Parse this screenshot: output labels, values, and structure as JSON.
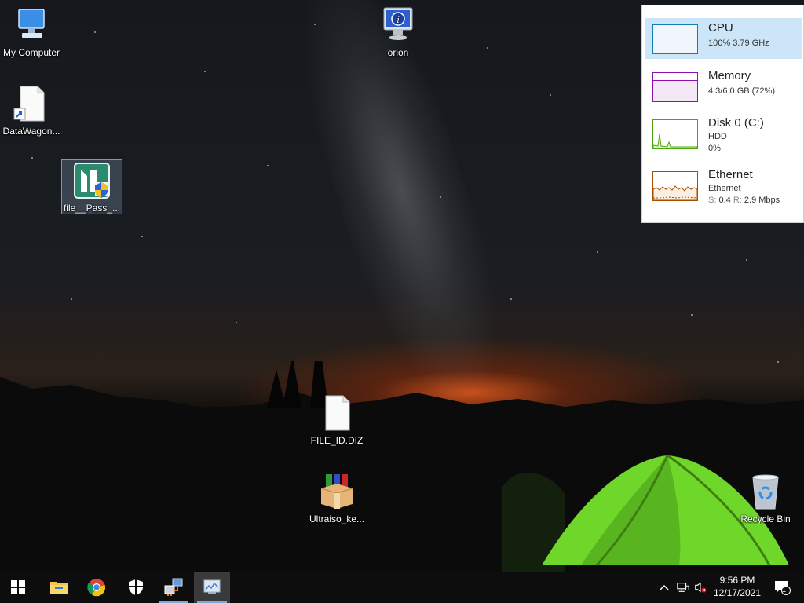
{
  "desktop_icons": {
    "my_computer": "My Computer",
    "orion": "orion",
    "datawagon": "DataWagon...",
    "file_pass": "file__Pass_...",
    "file_id": "FILE_ID.DIZ",
    "ultraiso": "Ultraiso_ke...",
    "recycle_bin": "Recycle Bin"
  },
  "performance": {
    "cpu": {
      "title": "CPU",
      "line1": "100%  3.79 GHz",
      "color": "#117dbb"
    },
    "memory": {
      "title": "Memory",
      "line1": "4.3/6.0 GB (72%)",
      "color": "#8b12ae"
    },
    "disk": {
      "title": "Disk 0 (C:)",
      "line1": "HDD",
      "line2": "0%",
      "color": "#4da60c"
    },
    "ethernet": {
      "title": "Ethernet",
      "line1": "Ethernet",
      "s_label": "S:",
      "s_value": "0.4",
      "r_label": "R:",
      "r_value": "2.9 Mbps",
      "color": "#a74f01"
    }
  },
  "taskbar": {
    "icons": [
      "windows-start-icon",
      "file-explorer-icon",
      "chrome-icon",
      "security-shield-icon",
      "network-app-icon",
      "task-manager-icon"
    ]
  },
  "tray": {
    "time": "9:56 PM",
    "date": "12/17/2021",
    "notification_count": "1"
  }
}
